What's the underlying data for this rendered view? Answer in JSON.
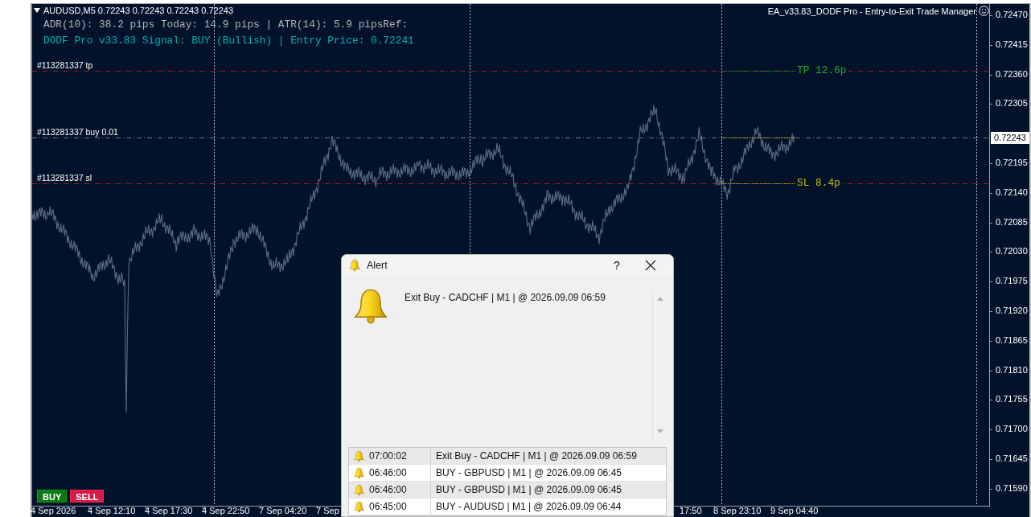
{
  "chart": {
    "symbol_header": "AUDUSD,M5  0.72243 0.72243 0.72243 0.72243",
    "info_lines": [
      {
        "text": "ADR(10): 38.2 pips   Today: 14.9 pips | ATR(14): 5.9 pipsRef:",
        "color": "#b4b4b4"
      },
      {
        "text": "DODF Pro v33.83 Signal: BUY (Bullish) | Entry Price: 0.72241",
        "color": "#00b4b4"
      }
    ],
    "expert_title": "EA_v33.83_DODF Pro - Entry-to-Exit Trade Manager",
    "order_lines": [
      {
        "label": "#113281337 tp",
        "kind": "tp"
      },
      {
        "label": "#113281337 buy 0.01",
        "kind": "entry"
      },
      {
        "label": "#113281337 sl",
        "kind": "sl"
      }
    ],
    "markers": [
      {
        "label": "TP 12.6p",
        "kind": "tp",
        "color": "#22b022"
      },
      {
        "label": "SL 8.4p",
        "kind": "sl",
        "color": "#c8c000"
      }
    ],
    "trade_buttons": [
      {
        "label": "BUY",
        "kind": "buy"
      },
      {
        "label": "SELL",
        "kind": "sell"
      }
    ],
    "price_axis": [
      "0.72470",
      "0.72415",
      "0.72360",
      "0.72305",
      "0.72195",
      "0.72140",
      "0.72085",
      "0.72030",
      "0.71975",
      "0.71920",
      "0.71865",
      "0.71810",
      "0.71755",
      "0.71700",
      "0.71645",
      "0.71590"
    ],
    "current_price": "0.72243",
    "time_axis": [
      "4 Sep 2026",
      "4 Sep 12:10",
      "4 Sep 17:30",
      "4 Sep 22:50",
      "7 Sep 04:20",
      "7 Sep",
      "17:50",
      "8 Sep 23:10",
      "9 Sep 04:40"
    ]
  },
  "alert_dialog": {
    "title": "Alert",
    "help": "?",
    "message": "Exit Buy - CADCHF | M1 | @ 2026.09.09 06:59",
    "history": [
      {
        "time": "07:00:02",
        "message": "Exit Buy - CADCHF | M1 | @ 2026.09.09 06:59"
      },
      {
        "time": "06:46:00",
        "message": "BUY - GBPUSD | M1 | @ 2026.09.09 06:45"
      },
      {
        "time": "06:46:00",
        "message": "BUY - GBPUSD | M1 | @ 2026.09.09 06:45"
      },
      {
        "time": "06:45:00",
        "message": "BUY - AUDUSD | M1 | @ 2026.09.09 06:44"
      }
    ]
  }
}
